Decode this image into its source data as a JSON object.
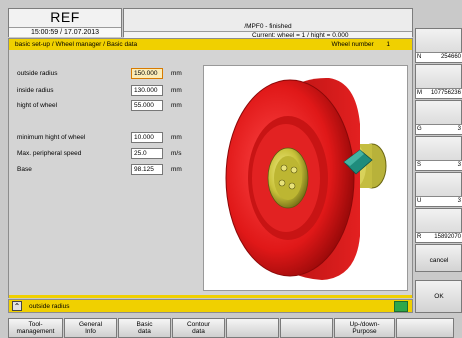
{
  "header": {
    "title": "REF",
    "datetime": "15:00:59 / 17.07.2013",
    "program": "/MPF0 - finished",
    "status": "Current:  wheel = 1   / hight = 0.000"
  },
  "breadcrumb": {
    "path": "basic set-up / Wheel manager / Basic data",
    "wheel_number_label": "Wheel number",
    "wheel_number": "1"
  },
  "fields": [
    {
      "label": "outside radius",
      "value": "150.000",
      "unit": "mm"
    },
    {
      "label": "inside radius",
      "value": "130.000",
      "unit": "mm"
    },
    {
      "label": "hight of wheel",
      "value": "55.000",
      "unit": "mm"
    },
    {
      "label": "minimum hight of wheel",
      "value": "10.000",
      "unit": "mm"
    },
    {
      "label": "Max. peripheral speed",
      "value": "25.0",
      "unit": "m/s"
    },
    {
      "label": "Base",
      "value": "98.125",
      "unit": "mm"
    }
  ],
  "status_line": {
    "text": "outside radius"
  },
  "bottom_softkeys": [
    {
      "label": "Tool-\nmanagement"
    },
    {
      "label": "General\nInfo"
    },
    {
      "label": "Basic\ndata"
    },
    {
      "label": "Contour\ndata"
    },
    {
      "label": ""
    },
    {
      "label": ""
    },
    {
      "label": "Up-/down-\nPurpose"
    },
    {
      "label": ""
    }
  ],
  "right_softkeys": [
    {
      "key": "N",
      "value": "254660"
    },
    {
      "key": "M",
      "value": "107756236"
    },
    {
      "key": "G",
      "value": "3"
    },
    {
      "key": "S",
      "value": "3"
    },
    {
      "key": "U",
      "value": "3"
    },
    {
      "key": "R",
      "value": "15892070"
    },
    {
      "label": "cancel"
    },
    {
      "label": "OK"
    }
  ],
  "colors": {
    "accent_yellow": "#f0d000",
    "wheel_red": "#e01818",
    "hub_yellow": "#c9c23a",
    "diamond_teal": "#1f8c7c",
    "ok_green": "#2fa84a"
  }
}
